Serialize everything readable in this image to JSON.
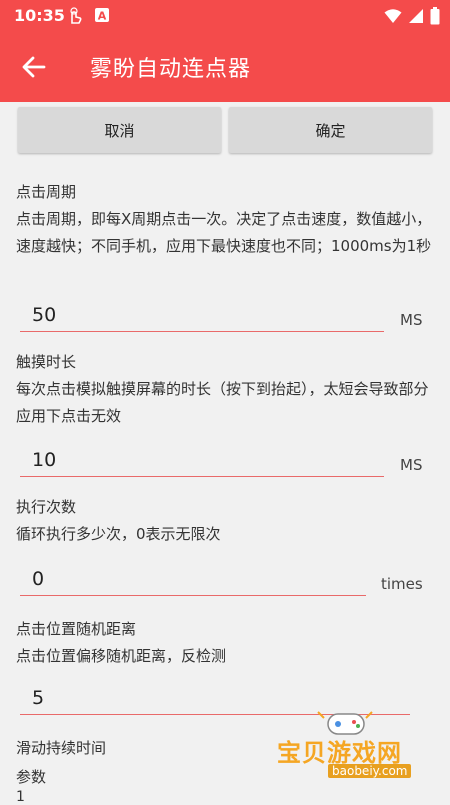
{
  "status_bar": {
    "time": "10:35",
    "icons": [
      "touch-gesture-icon",
      "a-box-icon",
      "wifi-icon",
      "signal-icon",
      "battery-icon"
    ]
  },
  "app_bar": {
    "title": "雾盼自动连点器",
    "back_icon": "arrow-left-icon",
    "color": "#f44b4b"
  },
  "actions": {
    "cancel_label": "取消",
    "confirm_label": "确定"
  },
  "sections": {
    "click_period": {
      "title": "点击周期",
      "description": "点击周期，即每X周期点击一次。决定了点击速度，数值越小，速度越快；不同手机，应用下最快速度也不同；1000ms为1秒",
      "value": "50",
      "unit": "MS"
    },
    "touch_duration": {
      "title": "触摸时长",
      "description": "每次点击模拟触摸屏幕的时长（按下到抬起），太短会导致部分应用下点击无效",
      "value": "10",
      "unit": "MS"
    },
    "repeat_count": {
      "title": "执行次数",
      "description": "循环执行多少次，0表示无限次",
      "value": "0",
      "unit": "times"
    },
    "random_offset": {
      "title": "点击位置随机距离",
      "description": "点击位置偏移随机距离，反检测",
      "value": "5"
    },
    "swipe_duration": {
      "title": "滑动持续时间",
      "param_label": "参数",
      "value": "1"
    }
  },
  "watermark": {
    "text": "宝贝游戏网",
    "url": "baobeiy.com"
  }
}
